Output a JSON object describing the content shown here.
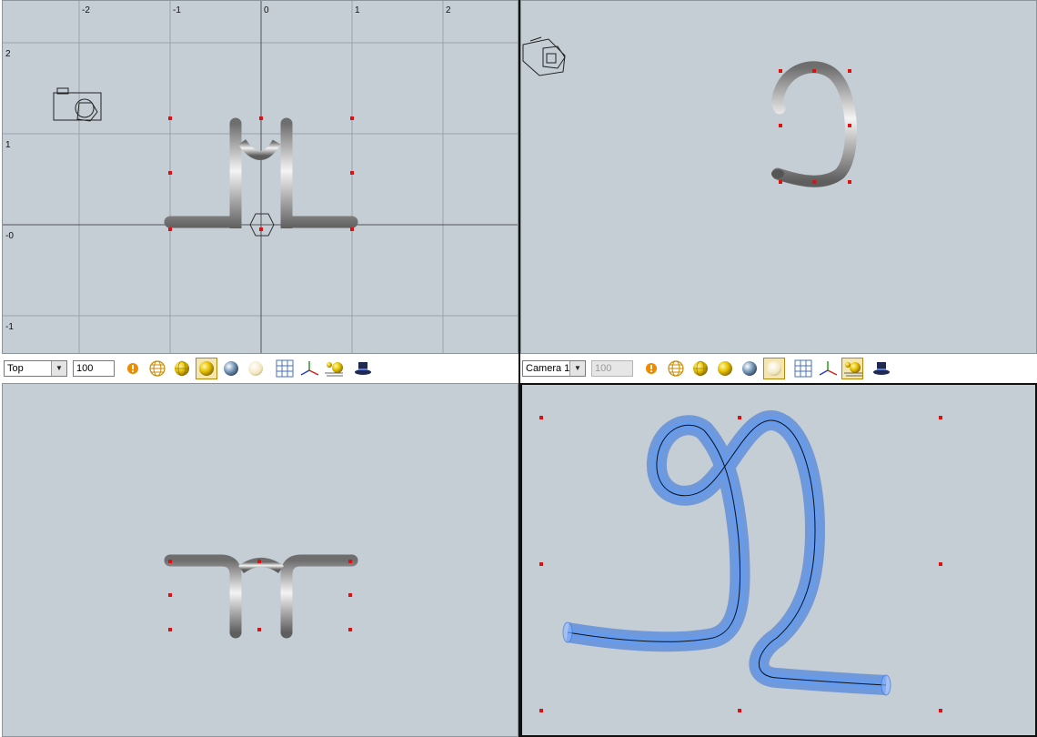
{
  "viewports": {
    "top_left": {
      "x_ticks": [
        "-2",
        "-1",
        "0",
        "1",
        "2"
      ],
      "y_ticks": [
        "2",
        "1",
        "-0",
        "-1"
      ]
    }
  },
  "toolbar_left": {
    "view_select": "Top",
    "zoom_value": "100"
  },
  "toolbar_right": {
    "view_select": "Camera 1",
    "zoom_value": "100"
  },
  "colors": {
    "viewport_bg": "#c5cdd5",
    "control_point": "#e01010",
    "tube_blue": "#2a6fe0",
    "tube_grey": "#b8b8b8"
  },
  "icons": [
    "alert-icon",
    "wireframe-sphere-icon",
    "flat-shaded-sphere-icon",
    "smooth-shaded-sphere-icon",
    "metal-sphere-icon",
    "light-sphere-icon",
    "grid-icon",
    "axes-icon",
    "lights-icon",
    "render-hat-icon"
  ]
}
